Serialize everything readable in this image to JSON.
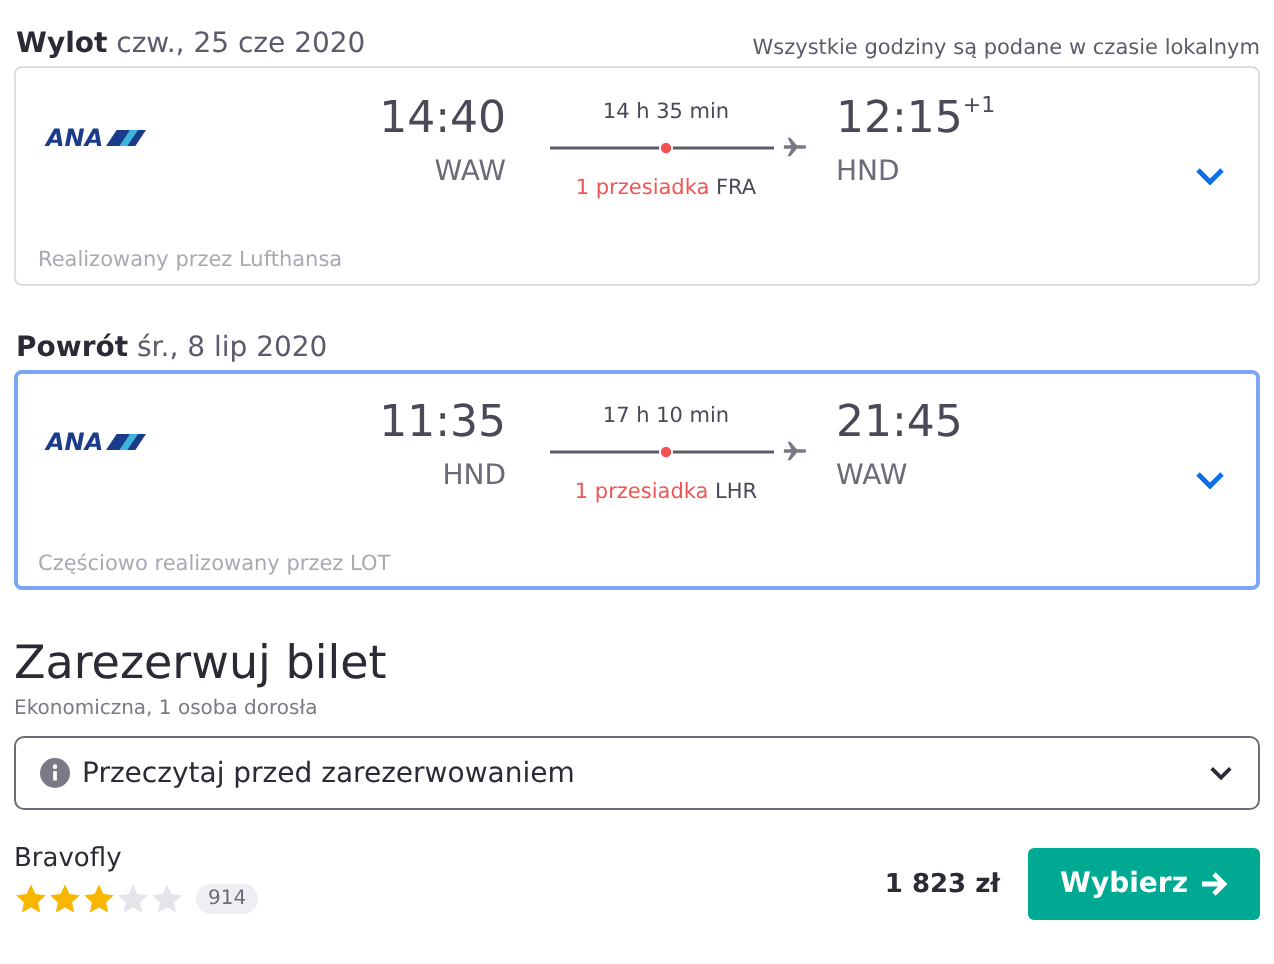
{
  "note": "Wszystkie godziny są podane w czasie lokalnym",
  "legs": [
    {
      "label": "Wylot",
      "date": "czw., 25 cze 2020",
      "selected": false,
      "airline": "ANA",
      "dep_time": "14:40",
      "dep_airport": "WAW",
      "duration": "14 h 35 min",
      "stops": "1 przesiadka",
      "via": "FRA",
      "arr_time": "12:15",
      "day_offset": "+1",
      "arr_airport": "HND",
      "operator": "Realizowany przez Lufthansa"
    },
    {
      "label": "Powrót",
      "date": "śr., 8 lip 2020",
      "selected": true,
      "airline": "ANA",
      "dep_time": "11:35",
      "dep_airport": "HND",
      "duration": "17 h 10 min",
      "stops": "1 przesiadka",
      "via": "LHR",
      "arr_time": "21:45",
      "arr_airport": "WAW",
      "operator": "Częściowo realizowany przez LOT"
    }
  ],
  "booking": {
    "title": "Zarezerwuj bilet",
    "subtitle": "Ekonomiczna, 1 osoba dorosła",
    "info": "Przeczytaj przed zarezerwowaniem",
    "provider": "Bravofly",
    "stars": 3,
    "reviews": "914",
    "price": "1 823 zł",
    "button": "Wybierz"
  }
}
